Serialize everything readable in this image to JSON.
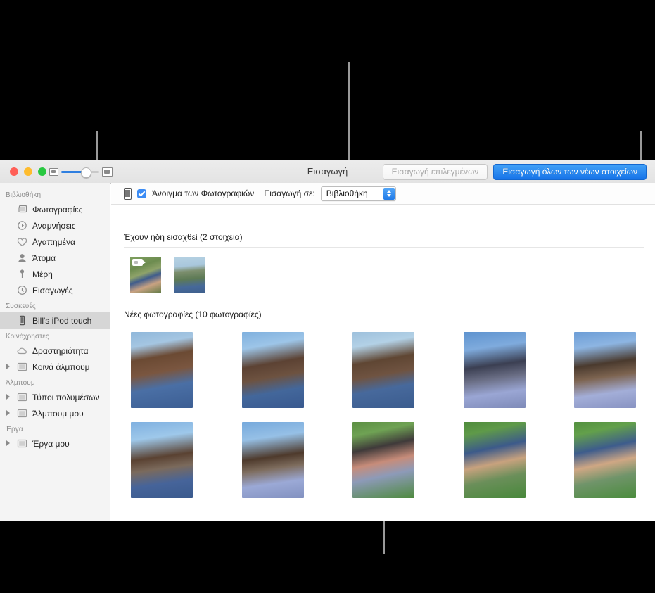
{
  "window": {
    "title": "Εισαγωγή",
    "traffic_lights": [
      "close",
      "minimize",
      "zoom"
    ],
    "buttons": {
      "import_selected": "Εισαγωγή επιλεγμένων",
      "import_all_new": "Εισαγωγή όλων των νέων στοιχείων"
    }
  },
  "import_bar": {
    "device_icon": "ipod-icon",
    "checkbox_label": "Άνοιγμα των Φωτογραφιών",
    "checkbox_checked": true,
    "import_to_label": "Εισαγωγή σε:",
    "import_to_value": "Βιβλιοθήκη"
  },
  "sidebar": {
    "groups": [
      {
        "header": "Βιβλιοθήκη",
        "items": [
          {
            "label": "Φωτογραφίες",
            "icon": "photos-icon",
            "disclosure": false,
            "selected": false
          },
          {
            "label": "Αναμνήσεις",
            "icon": "memories-icon",
            "disclosure": false,
            "selected": false
          },
          {
            "label": "Αγαπημένα",
            "icon": "heart-icon",
            "disclosure": false,
            "selected": false
          },
          {
            "label": "Άτομα",
            "icon": "person-icon",
            "disclosure": false,
            "selected": false
          },
          {
            "label": "Μέρη",
            "icon": "pin-icon",
            "disclosure": false,
            "selected": false
          },
          {
            "label": "Εισαγωγές",
            "icon": "clock-icon",
            "disclosure": false,
            "selected": false
          }
        ]
      },
      {
        "header": "Συσκευές",
        "items": [
          {
            "label": "Bill's iPod touch",
            "icon": "ipod-icon",
            "disclosure": false,
            "selected": true
          }
        ]
      },
      {
        "header": "Κοινόχρηστες",
        "items": [
          {
            "label": "Δραστηριότητα",
            "icon": "cloud-icon",
            "disclosure": false,
            "selected": false
          },
          {
            "label": "Κοινά άλμπουμ",
            "icon": "album-icon",
            "disclosure": true,
            "selected": false
          }
        ]
      },
      {
        "header": "Άλμπουμ",
        "items": [
          {
            "label": "Τύποι πολυμέσων",
            "icon": "album-icon",
            "disclosure": true,
            "selected": false
          },
          {
            "label": "Άλμπουμ μου",
            "icon": "album-icon",
            "disclosure": true,
            "selected": false
          }
        ]
      },
      {
        "header": "Έργα",
        "items": [
          {
            "label": "Έργα μου",
            "icon": "album-icon",
            "disclosure": true,
            "selected": false
          }
        ]
      }
    ]
  },
  "content": {
    "sections": [
      {
        "title": "Έχουν ήδη εισαχθεί (2 στοιχεία)",
        "items": [
          {
            "name": "two-girls-grass-video",
            "badge": "video",
            "c1": "#6f8f52",
            "c2": "#3c5a8a",
            "c3": "#d9b89a"
          },
          {
            "name": "girl-beach-portrait",
            "badge": "",
            "c1": "#9fc3d8",
            "c2": "#6b7f63",
            "c3": "#4a6f8f"
          }
        ]
      },
      {
        "title": "Νέες φωτογραφίες (10 φωτογραφίες)",
        "items": [
          {
            "name": "girl-looking-up",
            "badge": "",
            "c1": "#8fb7da",
            "c2": "#6b4a33",
            "c3": "#4a6fa5"
          },
          {
            "name": "girl-flowers-eyes",
            "badge": "",
            "c1": "#7fb0de",
            "c2": "#5c4233",
            "c3": "#43679b"
          },
          {
            "name": "girl-smiling-sea",
            "badge": "",
            "c1": "#9dc0dc",
            "c2": "#5f4633",
            "c3": "#47699c"
          },
          {
            "name": "two-friends-sunglasses",
            "badge": "",
            "c1": "#5e93cf",
            "c2": "#3b3f52",
            "c3": "#9aa6d4"
          },
          {
            "name": "two-friends-peace-sign",
            "badge": "",
            "c1": "#6c9dd6",
            "c2": "#4a3a2e",
            "c3": "#a3aed8"
          },
          {
            "name": "two-friends-field",
            "badge": "",
            "c1": "#7fb0e0",
            "c2": "#5a4232",
            "c3": "#46649a"
          },
          {
            "name": "two-friends-peace-v",
            "badge": "",
            "c1": "#76a9dc",
            "c2": "#4e3a2c",
            "c3": "#9ba9d6"
          },
          {
            "name": "girls-lying-grass-upside",
            "badge": "",
            "c1": "#5c8f43",
            "c2": "#3f3a3a",
            "c3": "#c78c7a"
          },
          {
            "name": "girls-grass-flower",
            "badge": "",
            "c1": "#4f8b3c",
            "c2": "#3c5a8a",
            "c3": "#c8a27e"
          },
          {
            "name": "girls-grass-looking",
            "badge": "",
            "c1": "#53903f",
            "c2": "#3d5c8c",
            "c3": "#cfa784"
          }
        ]
      }
    ]
  },
  "colors": {
    "accent": "#1673e8",
    "callout": "#9a9a9a",
    "sidebar_bg": "#f4f4f4",
    "selected_row": "#d6d6d6"
  }
}
